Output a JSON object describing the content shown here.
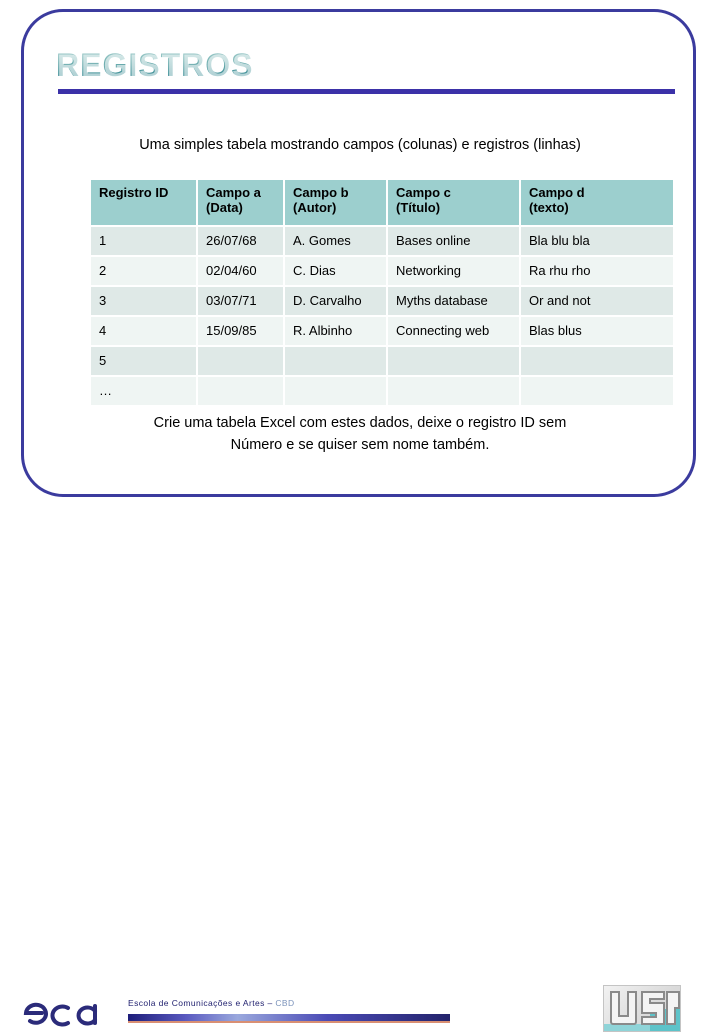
{
  "slide": {
    "title": "REGISTROS",
    "caption": "Uma simples tabela mostrando campos (colunas) e registros (linhas)",
    "instruction_line1": "Crie uma tabela Excel com estes dados, deixe o registro ID sem",
    "instruction_line2": "Número e se quiser sem nome também."
  },
  "table": {
    "headers": [
      {
        "line1": "Registro ID",
        "line2": ""
      },
      {
        "line1": "Campo a",
        "line2": "(Data)"
      },
      {
        "line1": "Campo b",
        "line2": "(Autor)"
      },
      {
        "line1": "Campo c",
        "line2": "(Título)"
      },
      {
        "line1": "Campo d",
        "line2": "(texto)"
      }
    ],
    "rows": [
      [
        "1",
        "26/07/68",
        "A. Gomes",
        "Bases online",
        "Bla blu bla"
      ],
      [
        "2",
        "02/04/60",
        "C. Dias",
        "Networking",
        "Ra rhu rho"
      ],
      [
        "3",
        "03/07/71",
        "D. Carvalho",
        "Myths database",
        "Or and not"
      ],
      [
        "4",
        "15/09/85",
        "R. Albinho",
        "Connecting web",
        "Blas blus"
      ],
      [
        "5",
        "",
        "",
        "",
        ""
      ],
      [
        "…",
        "",
        "",
        "",
        ""
      ]
    ]
  },
  "footer": {
    "institution": "Escola de Comunicações e Artes",
    "separator": " – ",
    "department": "CBD",
    "eca_logo_text": "eca",
    "usp_logo_text": "USP"
  },
  "colors": {
    "frame_blue": "#3b3b9e",
    "rule_blue": "#3b31a8",
    "header_teal": "#9ccfce",
    "row_dark": "#dfe9e7",
    "row_light": "#eff5f3",
    "title_teal": "#3f8f97",
    "footer_text_blue": "#1f1f6e",
    "footer_cbd_blue": "#7b93bb",
    "footer_underline": "#d98f73",
    "usp_teal": "#5dc3c9"
  }
}
